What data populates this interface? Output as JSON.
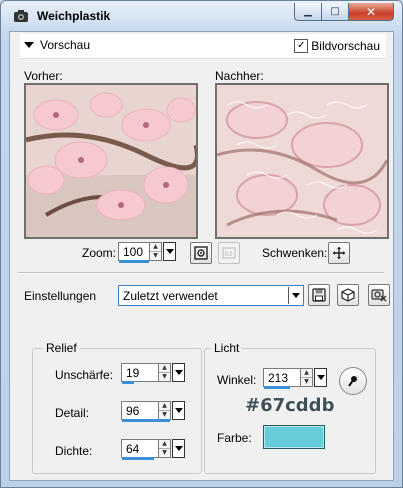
{
  "window": {
    "title": "Weichplastik",
    "minimize": "▁",
    "maximize": "□",
    "close": "✕"
  },
  "header": {
    "preview_toggle": "Vorschau",
    "bildvorschau_label": "Bildvorschau",
    "bildvorschau_checked": "✓"
  },
  "preview": {
    "before_label": "Vorher:",
    "after_label": "Nachher:"
  },
  "zoom": {
    "label": "Zoom:",
    "value": "100",
    "pan_label": "Schwenken:"
  },
  "settings": {
    "label": "Einstellungen",
    "preset": "Zuletzt verwendet"
  },
  "relief": {
    "title": "Relief",
    "sharpness_label": "Unschärfe:",
    "sharpness": "19",
    "detail_label": "Detail:",
    "detail": "96",
    "density_label": "Dichte:",
    "density": "64"
  },
  "light": {
    "title": "Licht",
    "angle_label": "Winkel:",
    "angle": "213",
    "color_label": "Farbe:",
    "color_hex": "#67cddb"
  },
  "colors": {
    "accent": "#3c8fd6",
    "swatch": "#67cddb"
  },
  "icons": [
    "camera-icon",
    "chevron-down-icon",
    "fit-icon",
    "actual-size-icon",
    "pan-crosshair-icon",
    "save-icon",
    "reset-icon",
    "delete-preset-icon",
    "angle-dial-icon"
  ]
}
